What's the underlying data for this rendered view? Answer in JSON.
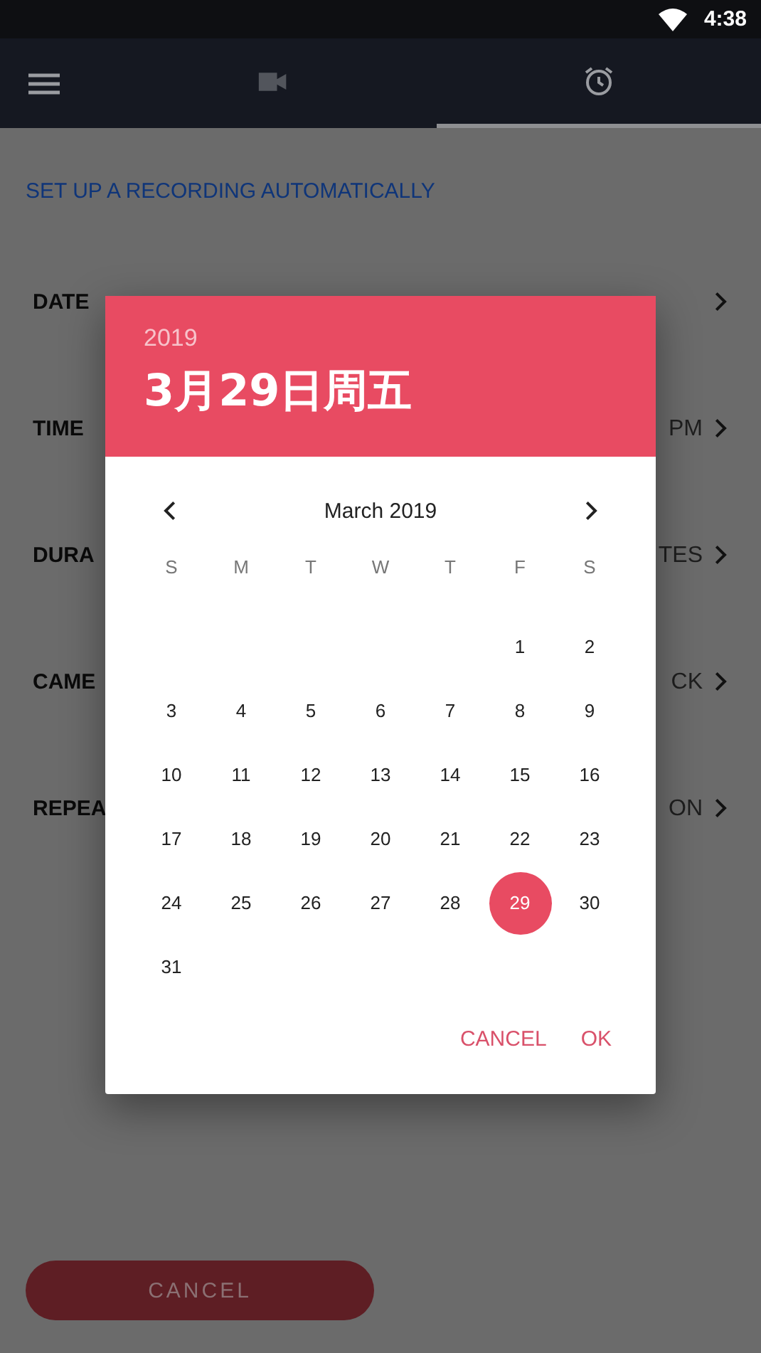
{
  "status_bar": {
    "time": "4:38"
  },
  "tabs": [
    {
      "kind": "video",
      "selected": false
    },
    {
      "kind": "alarm",
      "selected": true
    }
  ],
  "heading": "SET UP A RECORDING AUTOMATICALLY",
  "settings": [
    {
      "label": "DATE"
    },
    {
      "label": "TIME",
      "value": "PM"
    },
    {
      "label": "DURA",
      "value": "TES"
    },
    {
      "label": "CAME",
      "value": "CK"
    },
    {
      "label": "REPEA",
      "value": "ON"
    }
  ],
  "dialog": {
    "year": "2019",
    "date": "3月29日周五",
    "month": "March 2019",
    "weekdays": [
      "S",
      "M",
      "T",
      "W",
      "T",
      "F",
      "S"
    ],
    "weeks": [
      [
        {
          "day": "1",
          "selected": false
        },
        {
          "day": "2",
          "selected": false
        }
      ],
      [
        {
          "day": "3",
          "selected": false
        },
        {
          "day": "4",
          "selected": false
        },
        {
          "day": "5",
          "selected": false
        },
        {
          "day": "6",
          "selected": false
        },
        {
          "day": "7",
          "selected": false
        },
        {
          "day": "8",
          "selected": false
        },
        {
          "day": "9",
          "selected": false
        }
      ],
      [
        {
          "day": "10",
          "selected": false
        },
        {
          "day": "11",
          "selected": false
        },
        {
          "day": "12",
          "selected": false
        },
        {
          "day": "13",
          "selected": false
        },
        {
          "day": "14",
          "selected": false
        },
        {
          "day": "15",
          "selected": false
        },
        {
          "day": "16",
          "selected": false
        }
      ],
      [
        {
          "day": "17",
          "selected": false
        },
        {
          "day": "18",
          "selected": false
        },
        {
          "day": "19",
          "selected": false
        },
        {
          "day": "20",
          "selected": false
        },
        {
          "day": "21",
          "selected": false
        },
        {
          "day": "22",
          "selected": false
        },
        {
          "day": "23",
          "selected": false
        }
      ],
      [
        {
          "day": "24",
          "selected": false
        },
        {
          "day": "25",
          "selected": false
        },
        {
          "day": "26",
          "selected": false
        },
        {
          "day": "27",
          "selected": false
        },
        {
          "day": "28",
          "selected": false
        },
        {
          "day": "29",
          "selected": true
        },
        {
          "day": "30",
          "selected": false
        }
      ],
      [
        {
          "day": "31",
          "selected": false
        }
      ]
    ],
    "buttons": [
      "CANCEL",
      "OK"
    ]
  },
  "bottom_button": {
    "label": "CANCEL"
  }
}
